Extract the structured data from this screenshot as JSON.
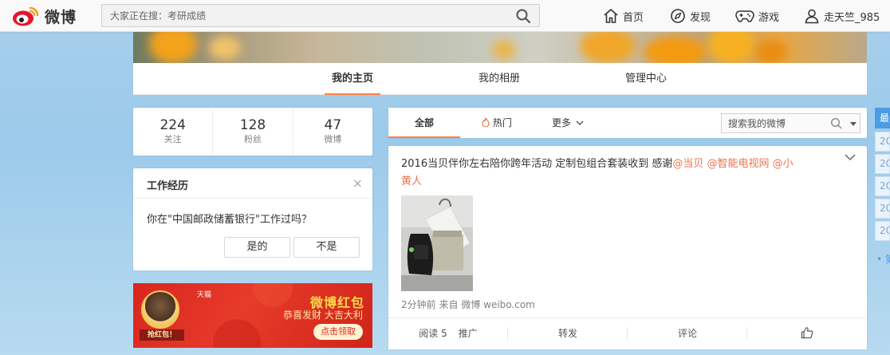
{
  "header": {
    "logo_text": "微博",
    "search_placeholder": "大家正在搜：考研成绩",
    "nav": {
      "home": "首页",
      "discover": "发现",
      "games": "游戏",
      "user": "走天竺_985"
    }
  },
  "profile_tabs": {
    "home": "我的主页",
    "album": "我的相册",
    "manage": "管理中心"
  },
  "counters": [
    {
      "value": "224",
      "label": "关注"
    },
    {
      "value": "128",
      "label": "粉丝"
    },
    {
      "value": "47",
      "label": "微博"
    }
  ],
  "work_card": {
    "title": "工作经历",
    "close": "×",
    "question": "你在\"中国邮政储蓄银行\"工作过吗？",
    "yes": "是的",
    "no": "不是"
  },
  "banner": {
    "brand": "天猫",
    "left_tag": "抢红包！",
    "title": "微博红包",
    "subtitle": "恭喜发财 大吉大利",
    "button": "点击领取"
  },
  "feed_tabs": {
    "all": "全部",
    "hot": "热门",
    "more": "更多",
    "search_placeholder": "搜索我的微博"
  },
  "post": {
    "text_plain": "2016当贝伴你左右陪你跨年活动  定制包组合套装收到 感谢",
    "mention1": "@当贝",
    "mention2": "@智能电视网",
    "mention3_a": "@小",
    "mention3_b": "黄人",
    "time": "2分钟前",
    "from_label": "来自",
    "source": "微博 weibo.com",
    "actions": {
      "read_label": "阅读 5",
      "promote": "推广",
      "repost": "转发",
      "comment": "评论"
    }
  },
  "right_sidebar": {
    "top_label": "最",
    "years": [
      "20",
      "20",
      "20",
      "20",
      "20"
    ],
    "more": "• 第"
  },
  "colors": {
    "accent": "#ff8140",
    "mention": "#eb7350",
    "sidebar_blue": "#4c9ce5",
    "banner_red": "#d8261f"
  }
}
